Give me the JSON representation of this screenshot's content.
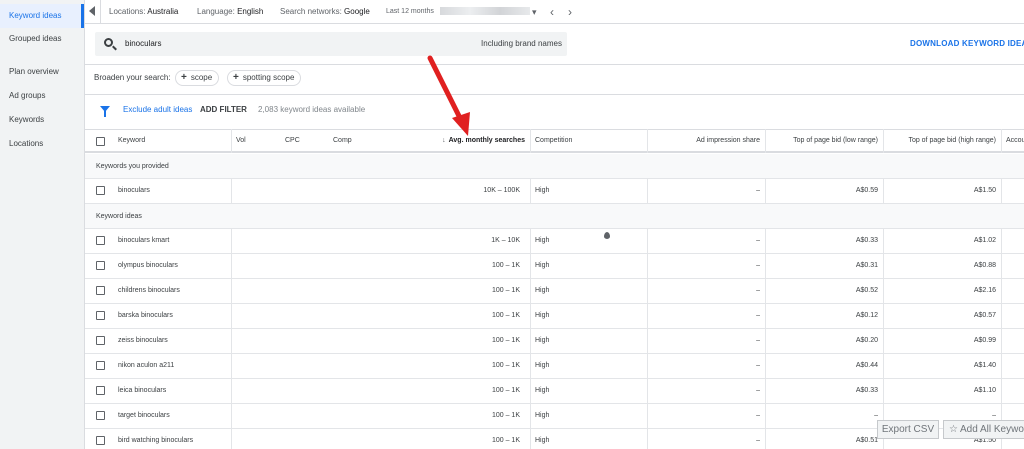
{
  "sidebar": {
    "items": [
      {
        "label": "Keyword ideas"
      },
      {
        "label": "Grouped ideas"
      },
      {
        "label": "Plan overview"
      },
      {
        "label": "Ad groups"
      },
      {
        "label": "Keywords"
      },
      {
        "label": "Locations"
      }
    ]
  },
  "topbar": {
    "locations_label": "Locations:",
    "locations_value": "Australia",
    "language_label": "Language:",
    "language_value": "English",
    "networks_label": "Search networks:",
    "networks_value": "Google",
    "date_label": "Last 12 months"
  },
  "search": {
    "query": "binoculars",
    "brand_label": "Including brand names",
    "download_label": "DOWNLOAD KEYWORD IDEAS"
  },
  "broaden": {
    "label": "Broaden your search:",
    "chips": [
      "scope",
      "spotting scope"
    ]
  },
  "filter": {
    "exclude_label": "Exclude adult ideas",
    "add_filter_label": "ADD FILTER",
    "count_label": "2,083 keyword ideas available"
  },
  "table": {
    "headers": {
      "keyword": "Keyword",
      "vol": "Vol",
      "cpc": "CPC",
      "comp": "Comp",
      "avg": "Avg. monthly searches",
      "competition": "Competition",
      "impression": "Ad impression share",
      "low_bid": "Top of page bid (low range)",
      "high_bid": "Top of page bid (high range)",
      "account": "Account status"
    },
    "sections": {
      "provided": "Keywords you provided",
      "ideas": "Keyword ideas"
    },
    "provided_rows": [
      {
        "keyword": "binoculars",
        "avg": "10K – 100K",
        "competition": "High",
        "impression": "–",
        "low": "A$0.59",
        "high": "A$1.50"
      }
    ],
    "idea_rows": [
      {
        "keyword": "binoculars kmart",
        "avg": "1K – 10K",
        "competition": "High",
        "impression": "–",
        "low": "A$0.33",
        "high": "A$1.02"
      },
      {
        "keyword": "olympus binoculars",
        "avg": "100 – 1K",
        "competition": "High",
        "impression": "–",
        "low": "A$0.31",
        "high": "A$0.88"
      },
      {
        "keyword": "childrens binoculars",
        "avg": "100 – 1K",
        "competition": "High",
        "impression": "–",
        "low": "A$0.52",
        "high": "A$2.16"
      },
      {
        "keyword": "barska binoculars",
        "avg": "100 – 1K",
        "competition": "High",
        "impression": "–",
        "low": "A$0.12",
        "high": "A$0.57"
      },
      {
        "keyword": "zeiss binoculars",
        "avg": "100 – 1K",
        "competition": "High",
        "impression": "–",
        "low": "A$0.20",
        "high": "A$0.99"
      },
      {
        "keyword": "nikon aculon a211",
        "avg": "100 – 1K",
        "competition": "High",
        "impression": "–",
        "low": "A$0.44",
        "high": "A$1.40"
      },
      {
        "keyword": "leica binoculars",
        "avg": "100 – 1K",
        "competition": "High",
        "impression": "–",
        "low": "A$0.33",
        "high": "A$1.10"
      },
      {
        "keyword": "target binoculars",
        "avg": "100 – 1K",
        "competition": "High",
        "impression": "–",
        "low": "–",
        "high": "–"
      },
      {
        "keyword": "bird watching binoculars",
        "avg": "100 – 1K",
        "competition": "High",
        "impression": "–",
        "low": "A$0.51",
        "high": "A$1.50"
      }
    ]
  },
  "actions": {
    "export_label": "Export CSV",
    "add_all_label": "Add All Keywords"
  },
  "colors": {
    "accent": "#1a73e8",
    "annotation": "#e02020"
  }
}
